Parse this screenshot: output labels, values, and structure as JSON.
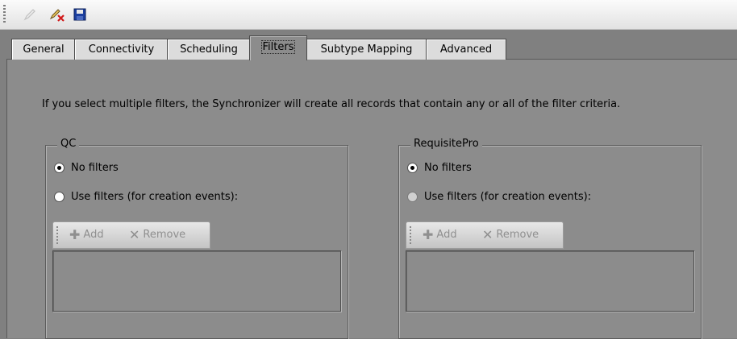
{
  "toolbar": {
    "buttons": [
      {
        "name": "edit-icon",
        "enabled": false
      },
      {
        "name": "edit-delete-icon",
        "enabled": true
      },
      {
        "name": "save-icon",
        "enabled": true
      }
    ]
  },
  "tabs": [
    {
      "label": "General",
      "active": false
    },
    {
      "label": "Connectivity",
      "active": false
    },
    {
      "label": "Scheduling",
      "active": false
    },
    {
      "label": "Filters",
      "active": true
    },
    {
      "label": "Subtype Mapping",
      "active": false
    },
    {
      "label": "Advanced",
      "active": false
    }
  ],
  "info_text": "If you select multiple filters, the Synchronizer will create all records that contain any or all of the filter criteria.",
  "groups": {
    "qc": {
      "title": "QC",
      "option_no_filters": "No filters",
      "option_use_filters": "Use filters (for creation events):",
      "selected": "no_filters",
      "add_label": "Add",
      "remove_label": "Remove"
    },
    "reqpro": {
      "title": "RequisitePro",
      "option_no_filters": "No filters",
      "option_use_filters": "Use filters (for creation events):",
      "selected": "no_filters",
      "add_label": "Add",
      "remove_label": "Remove"
    }
  },
  "colors": {
    "panel_bg": "#8c8c8c",
    "toolbar_bg": "#eeeeee",
    "disabled_text": "#8f8f8f"
  }
}
